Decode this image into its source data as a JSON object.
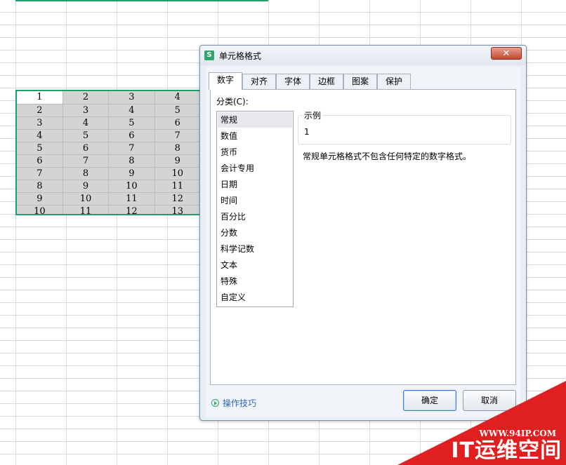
{
  "spreadsheet": {
    "rows": [
      [
        "1",
        "2",
        "3",
        "4"
      ],
      [
        "2",
        "3",
        "4",
        "5"
      ],
      [
        "3",
        "4",
        "5",
        "6"
      ],
      [
        "4",
        "5",
        "6",
        "7"
      ],
      [
        "5",
        "6",
        "7",
        "8"
      ],
      [
        "6",
        "7",
        "8",
        "9"
      ],
      [
        "7",
        "8",
        "9",
        "10"
      ],
      [
        "8",
        "9",
        "10",
        "11"
      ],
      [
        "9",
        "10",
        "11",
        "12"
      ],
      [
        "10",
        "11",
        "12",
        "13"
      ]
    ]
  },
  "dialog": {
    "title": "单元格格式",
    "app_icon": "S",
    "close_icon": "close-icon",
    "tabs": [
      {
        "label": "数字",
        "active": true
      },
      {
        "label": "对齐"
      },
      {
        "label": "字体"
      },
      {
        "label": "边框"
      },
      {
        "label": "图案"
      },
      {
        "label": "保护"
      }
    ],
    "category_label": "分类(C):",
    "categories": [
      "常规",
      "数值",
      "货币",
      "会计专用",
      "日期",
      "时间",
      "百分比",
      "分数",
      "科学记数",
      "文本",
      "特殊",
      "自定义"
    ],
    "selected_category": "常规",
    "sample_legend": "示例",
    "sample_value": "1",
    "description": "常规单元格格式不包含任何特定的数字格式。",
    "tip_label": "操作技巧",
    "ok_label": "确定",
    "cancel_label": "取消"
  },
  "watermark": {
    "url": "WWW.94IP.COM",
    "brand": "IT运维空间"
  },
  "colors": {
    "selection_border": "#1f9f6a",
    "watermark": "#e02020",
    "link": "#2b67b8"
  }
}
